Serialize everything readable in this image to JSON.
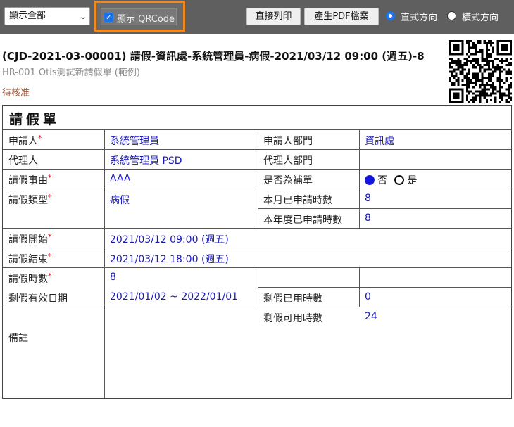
{
  "toolbar": {
    "filter_select": "顯示全部",
    "show_qrcode_label": "顯示 QRCode",
    "show_qrcode_checked": true,
    "print_button": "直接列印",
    "pdf_button": "產生PDF檔案",
    "orientation_portrait": "直式方向",
    "orientation_landscape": "橫式方向",
    "orientation_selected": "portrait"
  },
  "header": {
    "title": "(CJD-2021-03-00001) 請假-資訊處-系統管理員-病假-2021/03/12 09:00 (週五)-8",
    "subtitle": "HR-001 Otis測試新請假單 (範例)",
    "status": "待核准"
  },
  "form": {
    "title": "請假單",
    "applicant_label": "申請人",
    "applicant": "系統管理員",
    "applicant_dept_label": "申請人部門",
    "applicant_dept": "資訊處",
    "agent_label": "代理人",
    "agent": "系統管理員 PSD",
    "agent_dept_label": "代理人部門",
    "agent_dept": "",
    "reason_label": "請假事由",
    "reason": "AAA",
    "supplement_label": "是否為補單",
    "supplement_no": "否",
    "supplement_yes": "是",
    "leave_type_label": "請假類型",
    "leave_type": "病假",
    "month_hours_label": "本月已申請時數",
    "month_hours": "8",
    "year_hours_label": "本年度已申請時數",
    "year_hours": "8",
    "start_label": "請假開始",
    "start": "2021/03/12 09:00 (週五)",
    "end_label": "請假結束",
    "end": "2021/03/12 18:00 (週五)",
    "hours_label": "請假時數",
    "hours": "8",
    "valid_period_label": "剩假有效日期",
    "valid_period": "2021/01/02 ~ 2022/01/01",
    "used_label": "剩假已用時數",
    "used": "0",
    "available_label": "剩假可用時數",
    "available": "24",
    "remarks_label": "備註",
    "required_mark": "*"
  }
}
